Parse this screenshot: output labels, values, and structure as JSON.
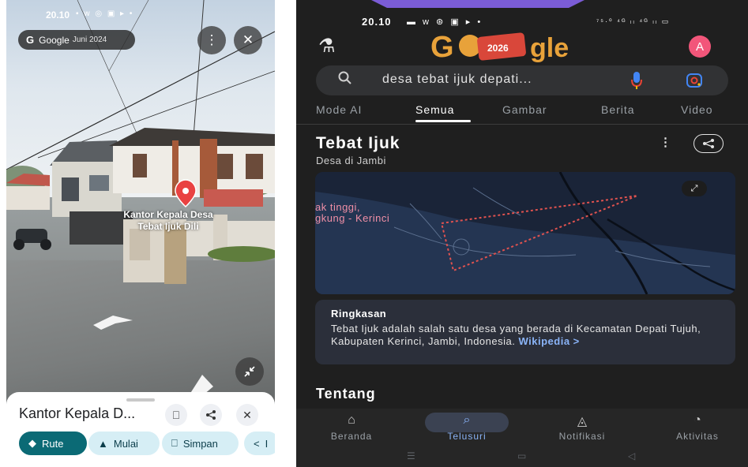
{
  "left_phone": {
    "status_time": "20.10",
    "status_icons": "▪ ᴡ ◎ ▣ ▸ •",
    "pill": {
      "brand": "Google",
      "date": "Juni 2024"
    },
    "more_icon": "⋮",
    "close_icon": "✕",
    "pin_label_line1": "Kantor Kepala Desa",
    "pin_label_line2": "Tebat Ijuk Dili",
    "sheet": {
      "title": "Kantor Kepala D...",
      "save_icon": "⎕",
      "share_icon": "⋖",
      "close_icon": "✕"
    },
    "chips": {
      "route": "Rute",
      "start": "Mulai",
      "save": "Simpan",
      "share": "I"
    }
  },
  "right_phone": {
    "status_time": "20.10",
    "status_icons": "▬ ᴡ ⊛ ▣ ▸ •",
    "status_right": "⁷⁵·⁰ ⁴ᴳ ₗₗ ⁴ᴳ ₗₗ ▭",
    "avatar_letter": "A",
    "doodle_year": "2026",
    "search_query": "desa tebat ijuk depati...",
    "tabs": [
      "Mode AI",
      "Semua",
      "Gambar",
      "Berita",
      "Video"
    ],
    "active_tab": "Semua",
    "kp_title": "Tebat Ijuk",
    "kp_subtitle": "Desa di Jambi",
    "map_label_line1": "ak tinggi,",
    "map_label_line2": "gkung - Kerinci",
    "summary_heading": "Ringkasan",
    "summary_text": "Tebat Ijuk adalah salah satu desa yang berada di Kecamatan Depati Tujuh, Kabupaten Kerinci, Jambi, Indonesia.",
    "summary_link": "Wikipedia >",
    "section_title": "Tentang",
    "nav": [
      "Beranda",
      "Telusuri",
      "Notifikasi",
      "Aktivitas"
    ]
  },
  "colors": {
    "accent_teal": "#0b6a75",
    "accent_pink": "#f2567a",
    "link_blue": "#8ab4f8",
    "route_dotted": "#e0524f"
  }
}
